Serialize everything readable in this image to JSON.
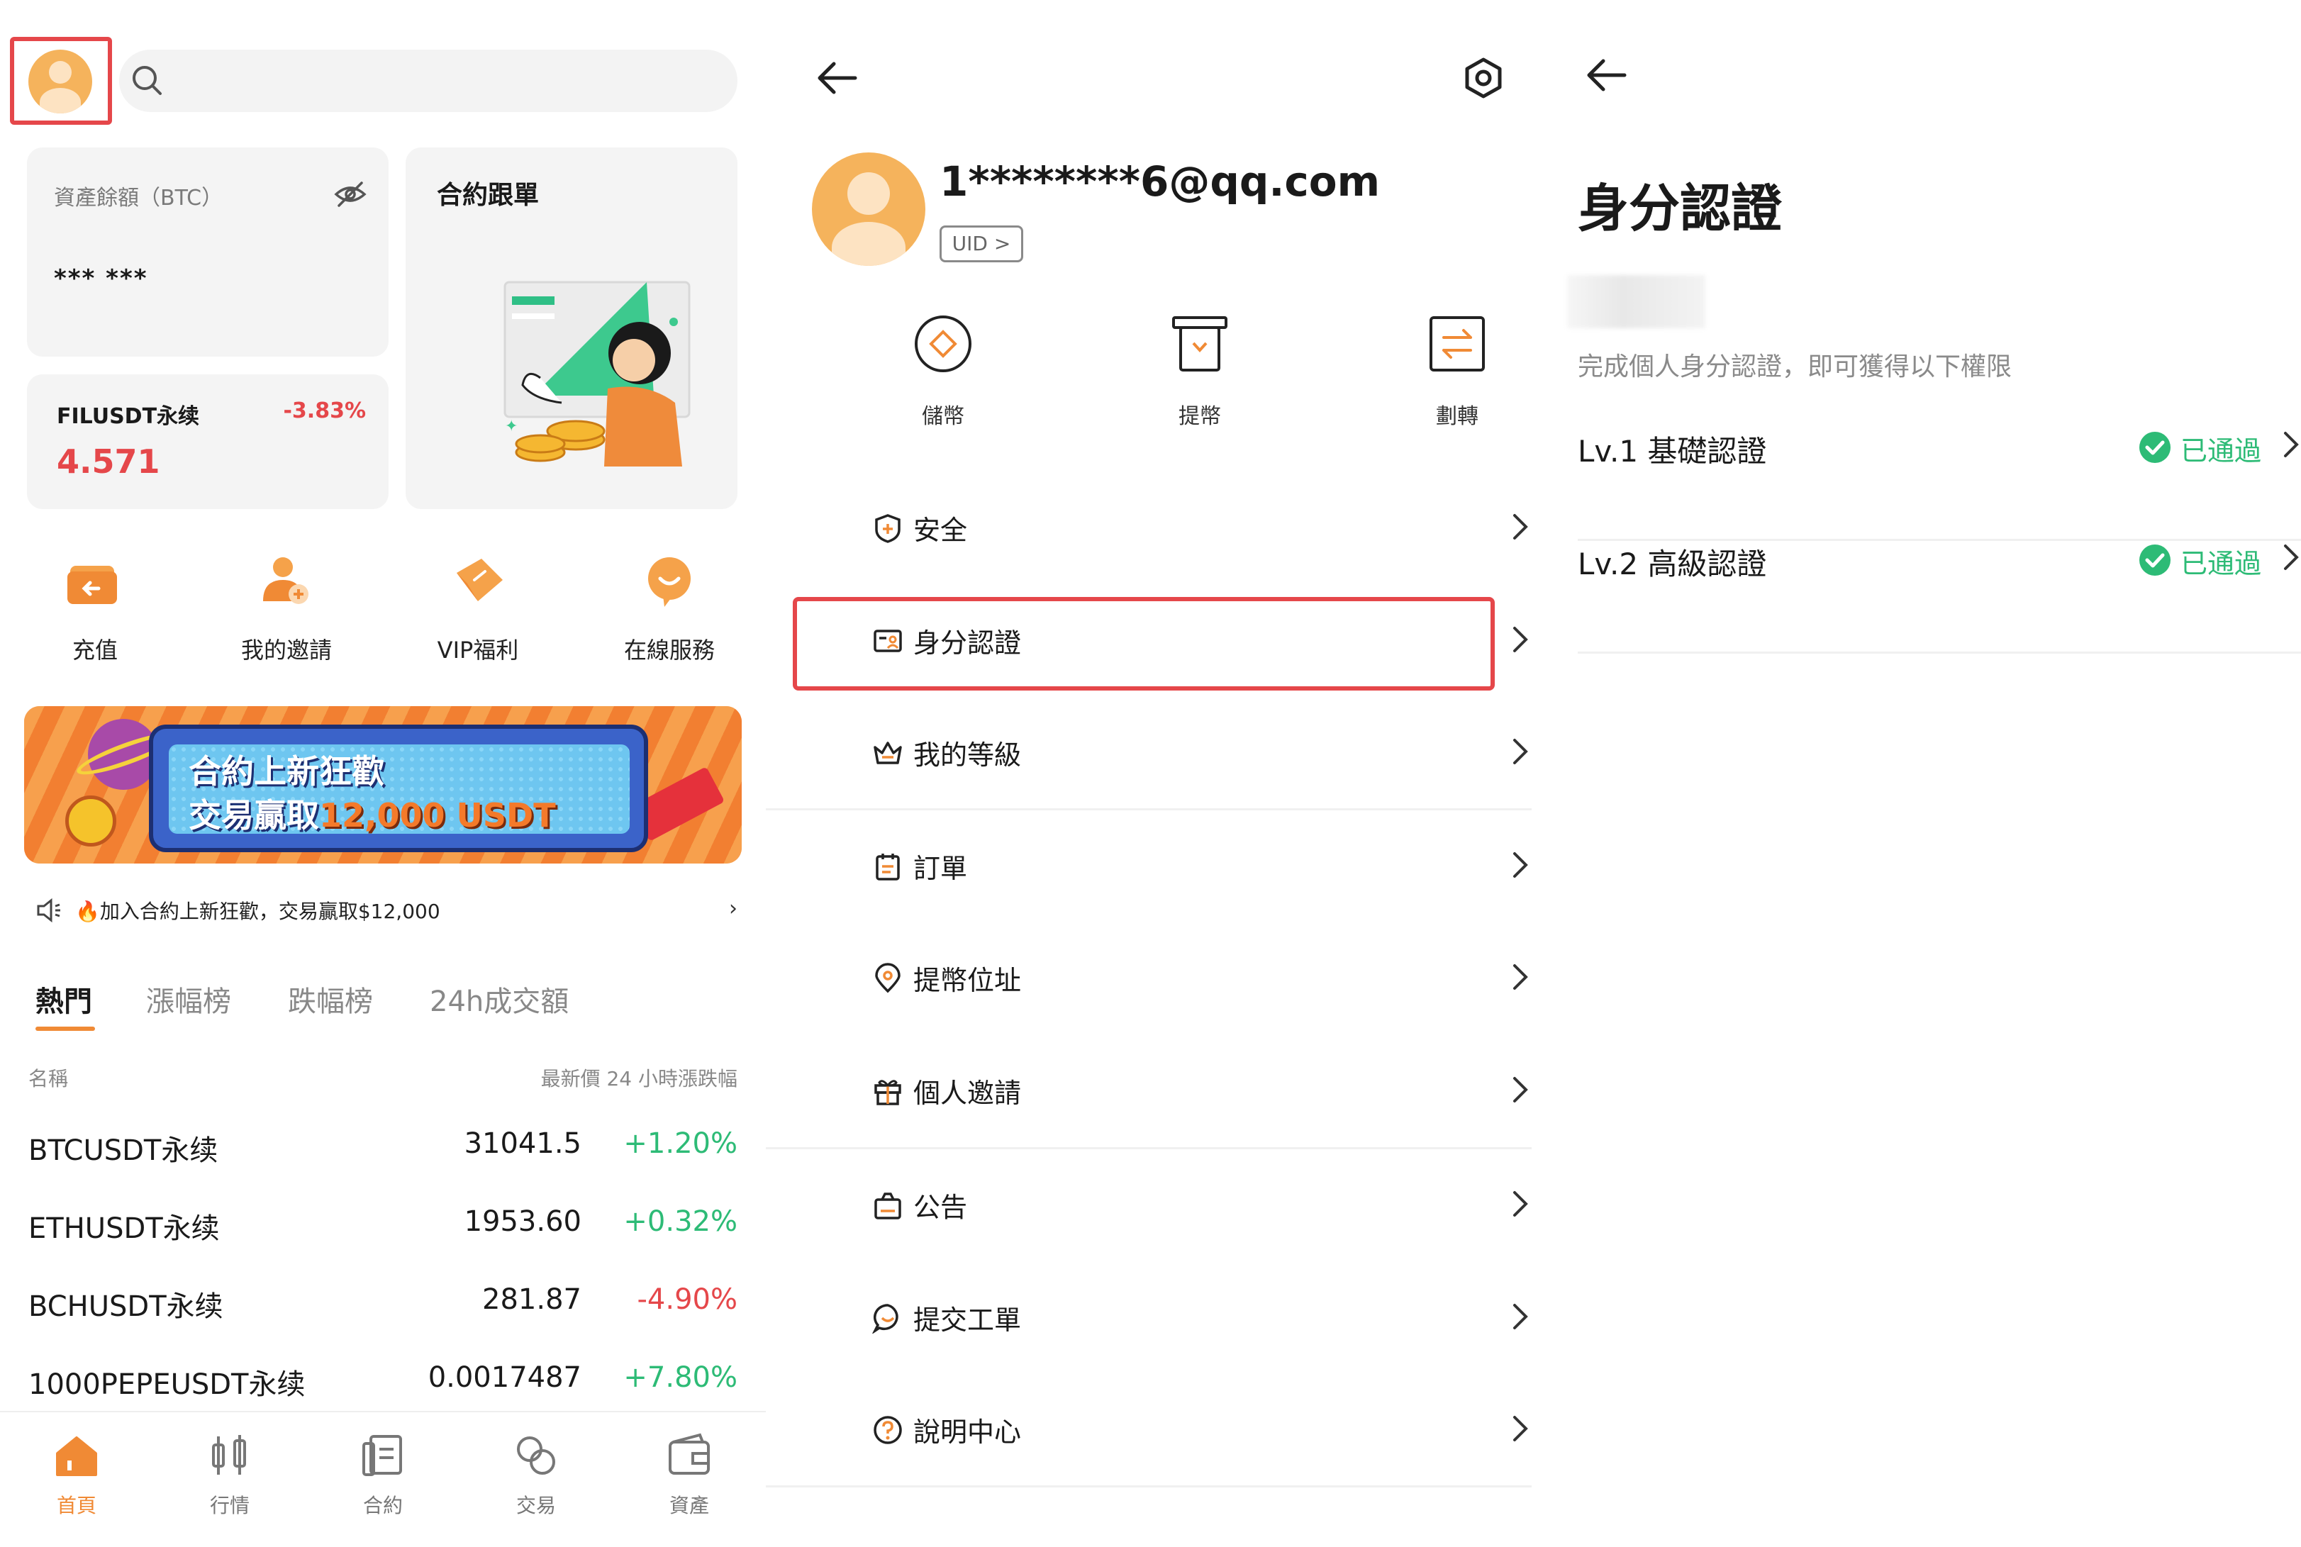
{
  "home": {
    "balance": {
      "label": "資產餘額（BTC）",
      "value": "*** ***"
    },
    "copy_trading": {
      "title": "合約跟單"
    },
    "ticker": {
      "name": "FILUSDT永续",
      "change": "-3.83%",
      "price": "4.571"
    },
    "quick_actions": [
      {
        "label": "充值",
        "icon": "deposit-wallet-icon"
      },
      {
        "label": "我的邀請",
        "icon": "invite-user-icon"
      },
      {
        "label": "VIP福利",
        "icon": "vip-diamond-icon"
      },
      {
        "label": "在線服務",
        "icon": "chat-bubble-icon"
      }
    ],
    "banner": {
      "line1": "合約上新狂歡",
      "line2_prefix": "交易贏取",
      "line2_accent": "12,000 USDT"
    },
    "notice": {
      "text": "🔥加入合約上新狂歡，交易贏取$12,000",
      "arrow": "›"
    },
    "tabs": [
      "熱門",
      "漲幅榜",
      "跌幅榜",
      "24h成交額"
    ],
    "market_header": {
      "name": "名稱",
      "right": "最新價  24 小時漲跌幅"
    },
    "market_rows": [
      {
        "symbol": "BTCUSDT永续",
        "price": "31041.5",
        "change": "+1.20%",
        "dir": "pos"
      },
      {
        "symbol": "ETHUSDT永续",
        "price": "1953.60",
        "change": "+0.32%",
        "dir": "pos"
      },
      {
        "symbol": "BCHUSDT永续",
        "price": "281.87",
        "change": "-4.90%",
        "dir": "neg"
      },
      {
        "symbol": "1000PEPEUSDT永续",
        "price": "0.0017487",
        "change": "+7.80%",
        "dir": "pos"
      }
    ],
    "bottom_nav": [
      {
        "label": "首頁",
        "icon": "home-icon",
        "active": true
      },
      {
        "label": "行情",
        "icon": "candlestick-icon",
        "active": false
      },
      {
        "label": "合約",
        "icon": "contract-doc-icon",
        "active": false
      },
      {
        "label": "交易",
        "icon": "trade-exchange-icon",
        "active": false
      },
      {
        "label": "資產",
        "icon": "wallet-icon",
        "active": false
      }
    ]
  },
  "profile": {
    "email": "1********6@qq.com",
    "uid_label": "UID >",
    "actions": [
      {
        "label": "儲幣",
        "icon": "deposit-icon"
      },
      {
        "label": "提幣",
        "icon": "withdraw-icon"
      },
      {
        "label": "劃轉",
        "icon": "transfer-icon"
      }
    ],
    "menu": [
      {
        "label": "安全",
        "icon": "shield-icon"
      },
      {
        "label": "身分認證",
        "icon": "id-card-icon"
      },
      {
        "label": "我的等級",
        "icon": "crown-icon"
      },
      {
        "label": "訂單",
        "icon": "clipboard-icon"
      },
      {
        "label": "提幣位址",
        "icon": "location-pin-icon"
      },
      {
        "label": "個人邀請",
        "icon": "gift-icon"
      },
      {
        "label": "公告",
        "icon": "bag-icon"
      },
      {
        "label": "提交工單",
        "icon": "chat-icon"
      },
      {
        "label": "說明中心",
        "icon": "help-icon"
      }
    ]
  },
  "verification": {
    "title": "身分認證",
    "description": "完成個人身分認證，即可獲得以下權限",
    "levels": [
      {
        "label": "Lv.1 基礎認證",
        "status": "已通過"
      },
      {
        "label": "Lv.2 高級認證",
        "status": "已通過"
      }
    ]
  },
  "colors": {
    "accent": "#f08a35",
    "highlight": "#e5474a",
    "positive": "#2dbb76",
    "negative": "#e5474a"
  }
}
